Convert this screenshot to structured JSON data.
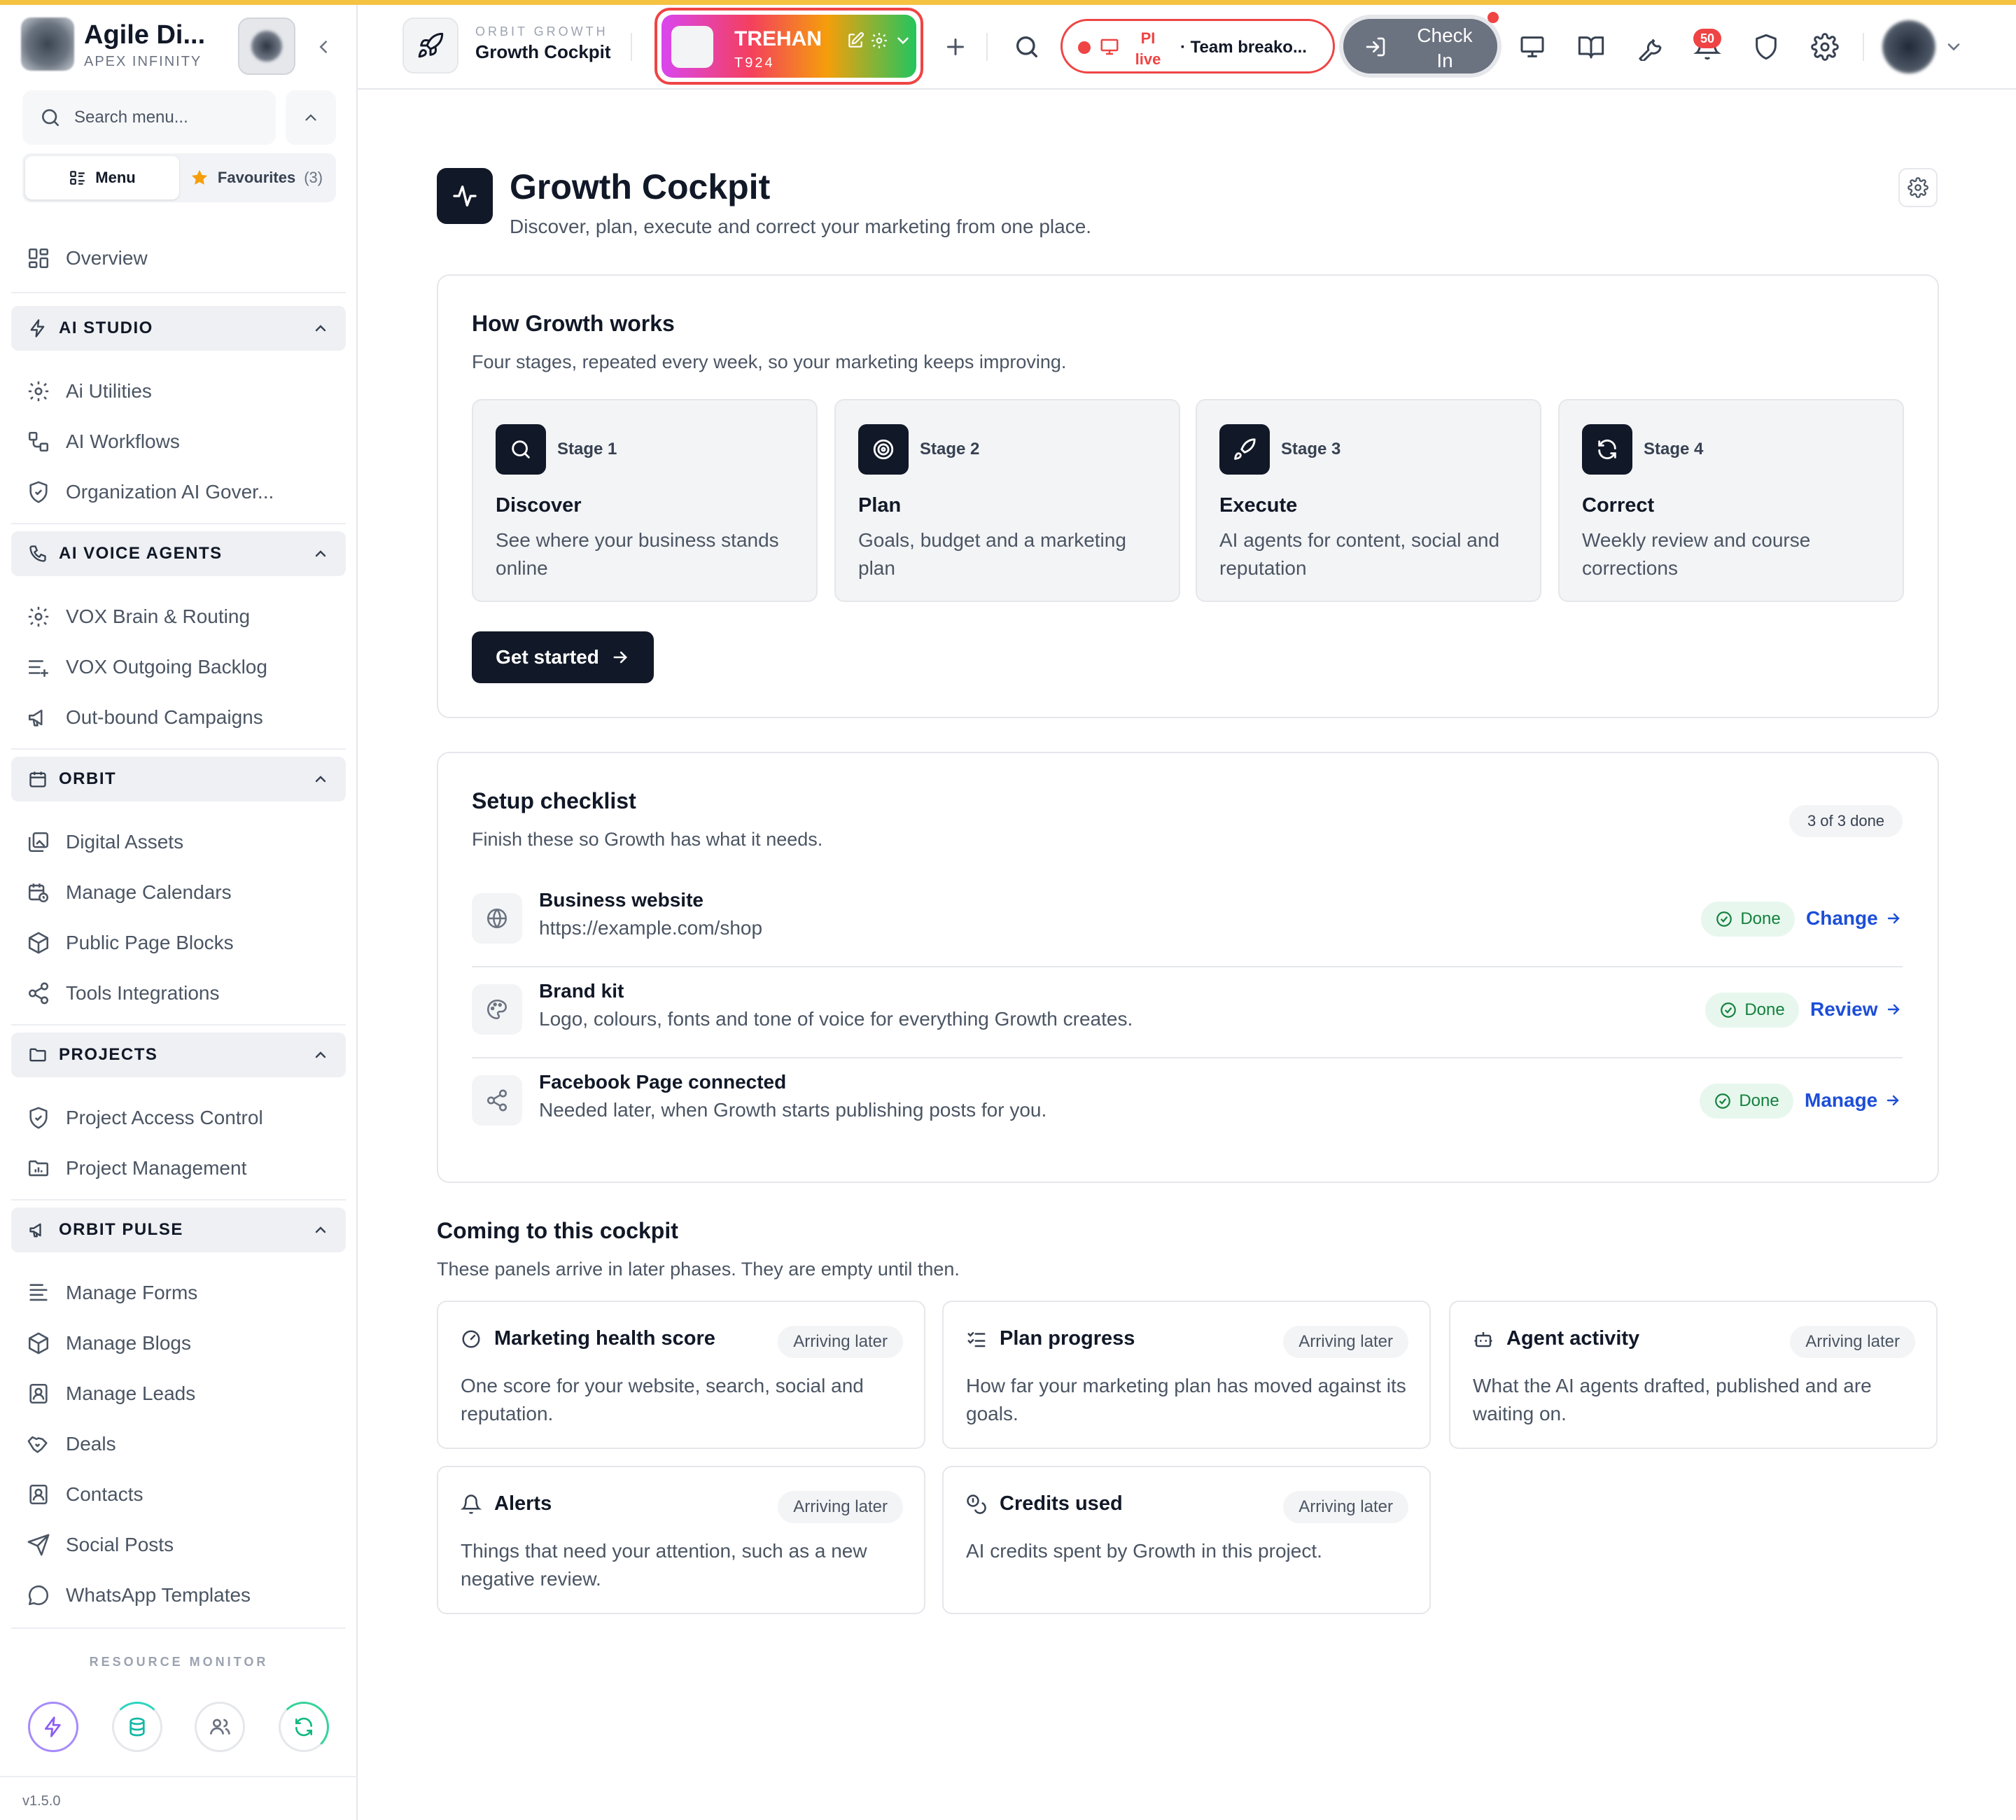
{
  "brand": {
    "name": "Agile Di...",
    "subtitle": "APEX INFINITY"
  },
  "sidebar": {
    "search_placeholder": "Search menu...",
    "tabs": {
      "menu": "Menu",
      "favourites": "Favourites",
      "favourites_count": "(3)"
    },
    "overview": "Overview",
    "sections": [
      {
        "title": "AI STUDIO",
        "items": [
          "Ai Utilities",
          "AI Workflows",
          "Organization AI Gover..."
        ]
      },
      {
        "title": "AI VOICE AGENTS",
        "items": [
          "VOX Brain & Routing",
          "VOX Outgoing Backlog",
          "Out-bound Campaigns"
        ]
      },
      {
        "title": "ORBIT",
        "items": [
          "Digital Assets",
          "Manage Calendars",
          "Public Page Blocks",
          "Tools Integrations"
        ]
      },
      {
        "title": "PROJECTS",
        "items": [
          "Project Access Control",
          "Project Management"
        ]
      },
      {
        "title": "ORBIT PULSE",
        "items": [
          "Manage Forms",
          "Manage Blogs",
          "Manage Leads",
          "Deals",
          "Contacts",
          "Social Posts",
          "WhatsApp Templates"
        ]
      }
    ],
    "resource_monitor_label": "RESOURCE MONITOR",
    "version": "v1.5.0"
  },
  "topbar": {
    "kicker": "ORBIT GROWTH",
    "title": "Growth Cockpit",
    "project": {
      "name": "TREHAN",
      "code": "T924"
    },
    "live": {
      "label": "PI live",
      "meeting": "· Team breako..."
    },
    "checkin_label": "Check In",
    "notifications_count": "50"
  },
  "page": {
    "title": "Growth Cockpit",
    "subtitle": "Discover, plan, execute and correct your marketing from one place."
  },
  "how": {
    "title": "How Growth works",
    "subtitle": "Four stages, repeated every week, so your marketing keeps improving.",
    "stages": [
      {
        "num": "Stage 1",
        "name": "Discover",
        "desc": "See where your business stands online",
        "icon": "search-icon"
      },
      {
        "num": "Stage 2",
        "name": "Plan",
        "desc": "Goals, budget and a marketing plan",
        "icon": "target-icon"
      },
      {
        "num": "Stage 3",
        "name": "Execute",
        "desc": "AI agents for content, social and reputation",
        "icon": "rocket-icon"
      },
      {
        "num": "Stage 4",
        "name": "Correct",
        "desc": "Weekly review and course corrections",
        "icon": "refresh-icon"
      }
    ],
    "cta": "Get started"
  },
  "checklist": {
    "title": "Setup checklist",
    "subtitle": "Finish these so Growth has what it needs.",
    "progress": "3 of 3 done",
    "items": [
      {
        "title": "Business website",
        "desc": "https://example.com/shop",
        "status": "Done",
        "action": "Change",
        "icon": "globe-icon"
      },
      {
        "title": "Brand kit",
        "desc": "Logo, colours, fonts and tone of voice for everything Growth creates.",
        "status": "Done",
        "action": "Review",
        "icon": "palette-icon"
      },
      {
        "title": "Facebook Page connected",
        "desc": "Needed later, when Growth starts publishing posts for you.",
        "status": "Done",
        "action": "Manage",
        "icon": "share-icon"
      }
    ]
  },
  "coming": {
    "title": "Coming to this cockpit",
    "subtitle": "These panels arrive in later phases. They are empty until then.",
    "panels": [
      {
        "title": "Marketing health score",
        "badge": "Arriving later",
        "desc": "One score for your website, search, social and reputation.",
        "icon": "gauge-icon"
      },
      {
        "title": "Plan progress",
        "badge": "Arriving later",
        "desc": "How far your marketing plan has moved against its goals.",
        "icon": "list-check-icon"
      },
      {
        "title": "Agent activity",
        "badge": "Arriving later",
        "desc": "What the AI agents drafted, published and are waiting on.",
        "icon": "bot-icon"
      },
      {
        "title": "Alerts",
        "badge": "Arriving later",
        "desc": "Things that need your attention, such as a new negative review.",
        "icon": "bell-icon"
      },
      {
        "title": "Credits used",
        "badge": "Arriving later",
        "desc": "AI credits spent by Growth in this project.",
        "icon": "coins-icon"
      }
    ]
  },
  "colors": {
    "accent": "#111827",
    "link": "#1d4ed8",
    "done": "#15803d",
    "alert": "#ef4444",
    "stripe": "#f5c242"
  }
}
